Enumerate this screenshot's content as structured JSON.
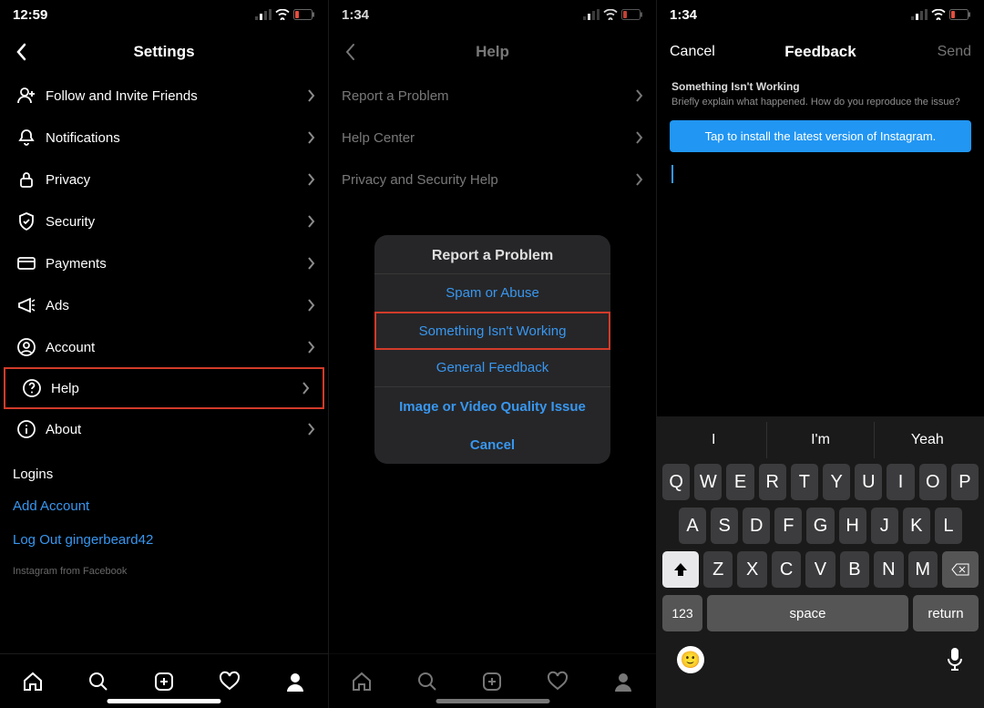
{
  "phone1": {
    "time": "12:59",
    "title": "Settings",
    "items": [
      {
        "icon": "invite-icon",
        "label": "Follow and Invite Friends"
      },
      {
        "icon": "bell-icon",
        "label": "Notifications"
      },
      {
        "icon": "lock-icon",
        "label": "Privacy"
      },
      {
        "icon": "shield-icon",
        "label": "Security"
      },
      {
        "icon": "card-icon",
        "label": "Payments"
      },
      {
        "icon": "megaphone-icon",
        "label": "Ads"
      },
      {
        "icon": "account-icon",
        "label": "Account"
      },
      {
        "icon": "help-icon",
        "label": "Help"
      },
      {
        "icon": "info-icon",
        "label": "About"
      }
    ],
    "highlighted_index": 7,
    "logins_label": "Logins",
    "add_account": "Add Account",
    "logout": "Log Out gingerbeard42",
    "footer": "Instagram from Facebook"
  },
  "phone2": {
    "time": "1:34",
    "title": "Help",
    "items": [
      {
        "label": "Report a Problem"
      },
      {
        "label": "Help Center"
      },
      {
        "label": "Privacy and Security Help"
      }
    ],
    "sheet": {
      "title": "Report a Problem",
      "options": [
        "Spam or Abuse",
        "Something Isn't Working",
        "General Feedback",
        "Image or Video Quality Issue"
      ],
      "cancel": "Cancel",
      "highlighted_index": 1
    }
  },
  "phone3": {
    "time": "1:34",
    "title": "Feedback",
    "cancel": "Cancel",
    "send": "Send",
    "header": "Something Isn't Working",
    "subheader": "Briefly explain what happened. How do you reproduce the issue?",
    "banner": "Tap to install the latest version of Instagram.",
    "keyboard": {
      "suggestions": [
        "I",
        "I'm",
        "Yeah"
      ],
      "row1": [
        "Q",
        "W",
        "E",
        "R",
        "T",
        "Y",
        "U",
        "I",
        "O",
        "P"
      ],
      "row2": [
        "A",
        "S",
        "D",
        "F",
        "G",
        "H",
        "J",
        "K",
        "L"
      ],
      "row3": [
        "Z",
        "X",
        "C",
        "V",
        "B",
        "N",
        "M"
      ],
      "numkey": "123",
      "space": "space",
      "return": "return"
    }
  }
}
